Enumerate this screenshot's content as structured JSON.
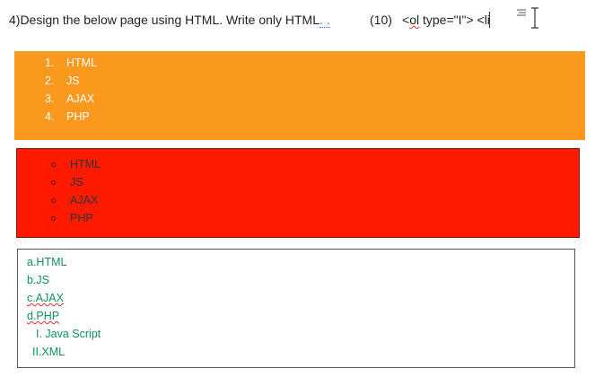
{
  "header": {
    "question": "4)Design the below page using HTML. Write only HTML",
    "question_tail": ". .",
    "marks": "(10)",
    "code_prefix": "<",
    "code_ol": "ol",
    "code_rest": " type=\"I\"> <li"
  },
  "ordered_list": {
    "background": "#fb991f",
    "items": [
      {
        "num": "1.",
        "text": "HTML"
      },
      {
        "num": "2.",
        "text": "JS"
      },
      {
        "num": "3.",
        "text": "AJAX"
      },
      {
        "num": "4.",
        "text": "PHP"
      }
    ]
  },
  "unordered_list": {
    "background": "#ff1a00",
    "items": [
      "HTML",
      "JS",
      "AJAX",
      "PHP"
    ]
  },
  "alpha_list": {
    "color": "#12905a",
    "items": [
      "a.HTML",
      "b.JS",
      "c.AJAX",
      "d.PHP"
    ],
    "roman_items": [
      "I. Java Script",
      "II.XML"
    ]
  }
}
